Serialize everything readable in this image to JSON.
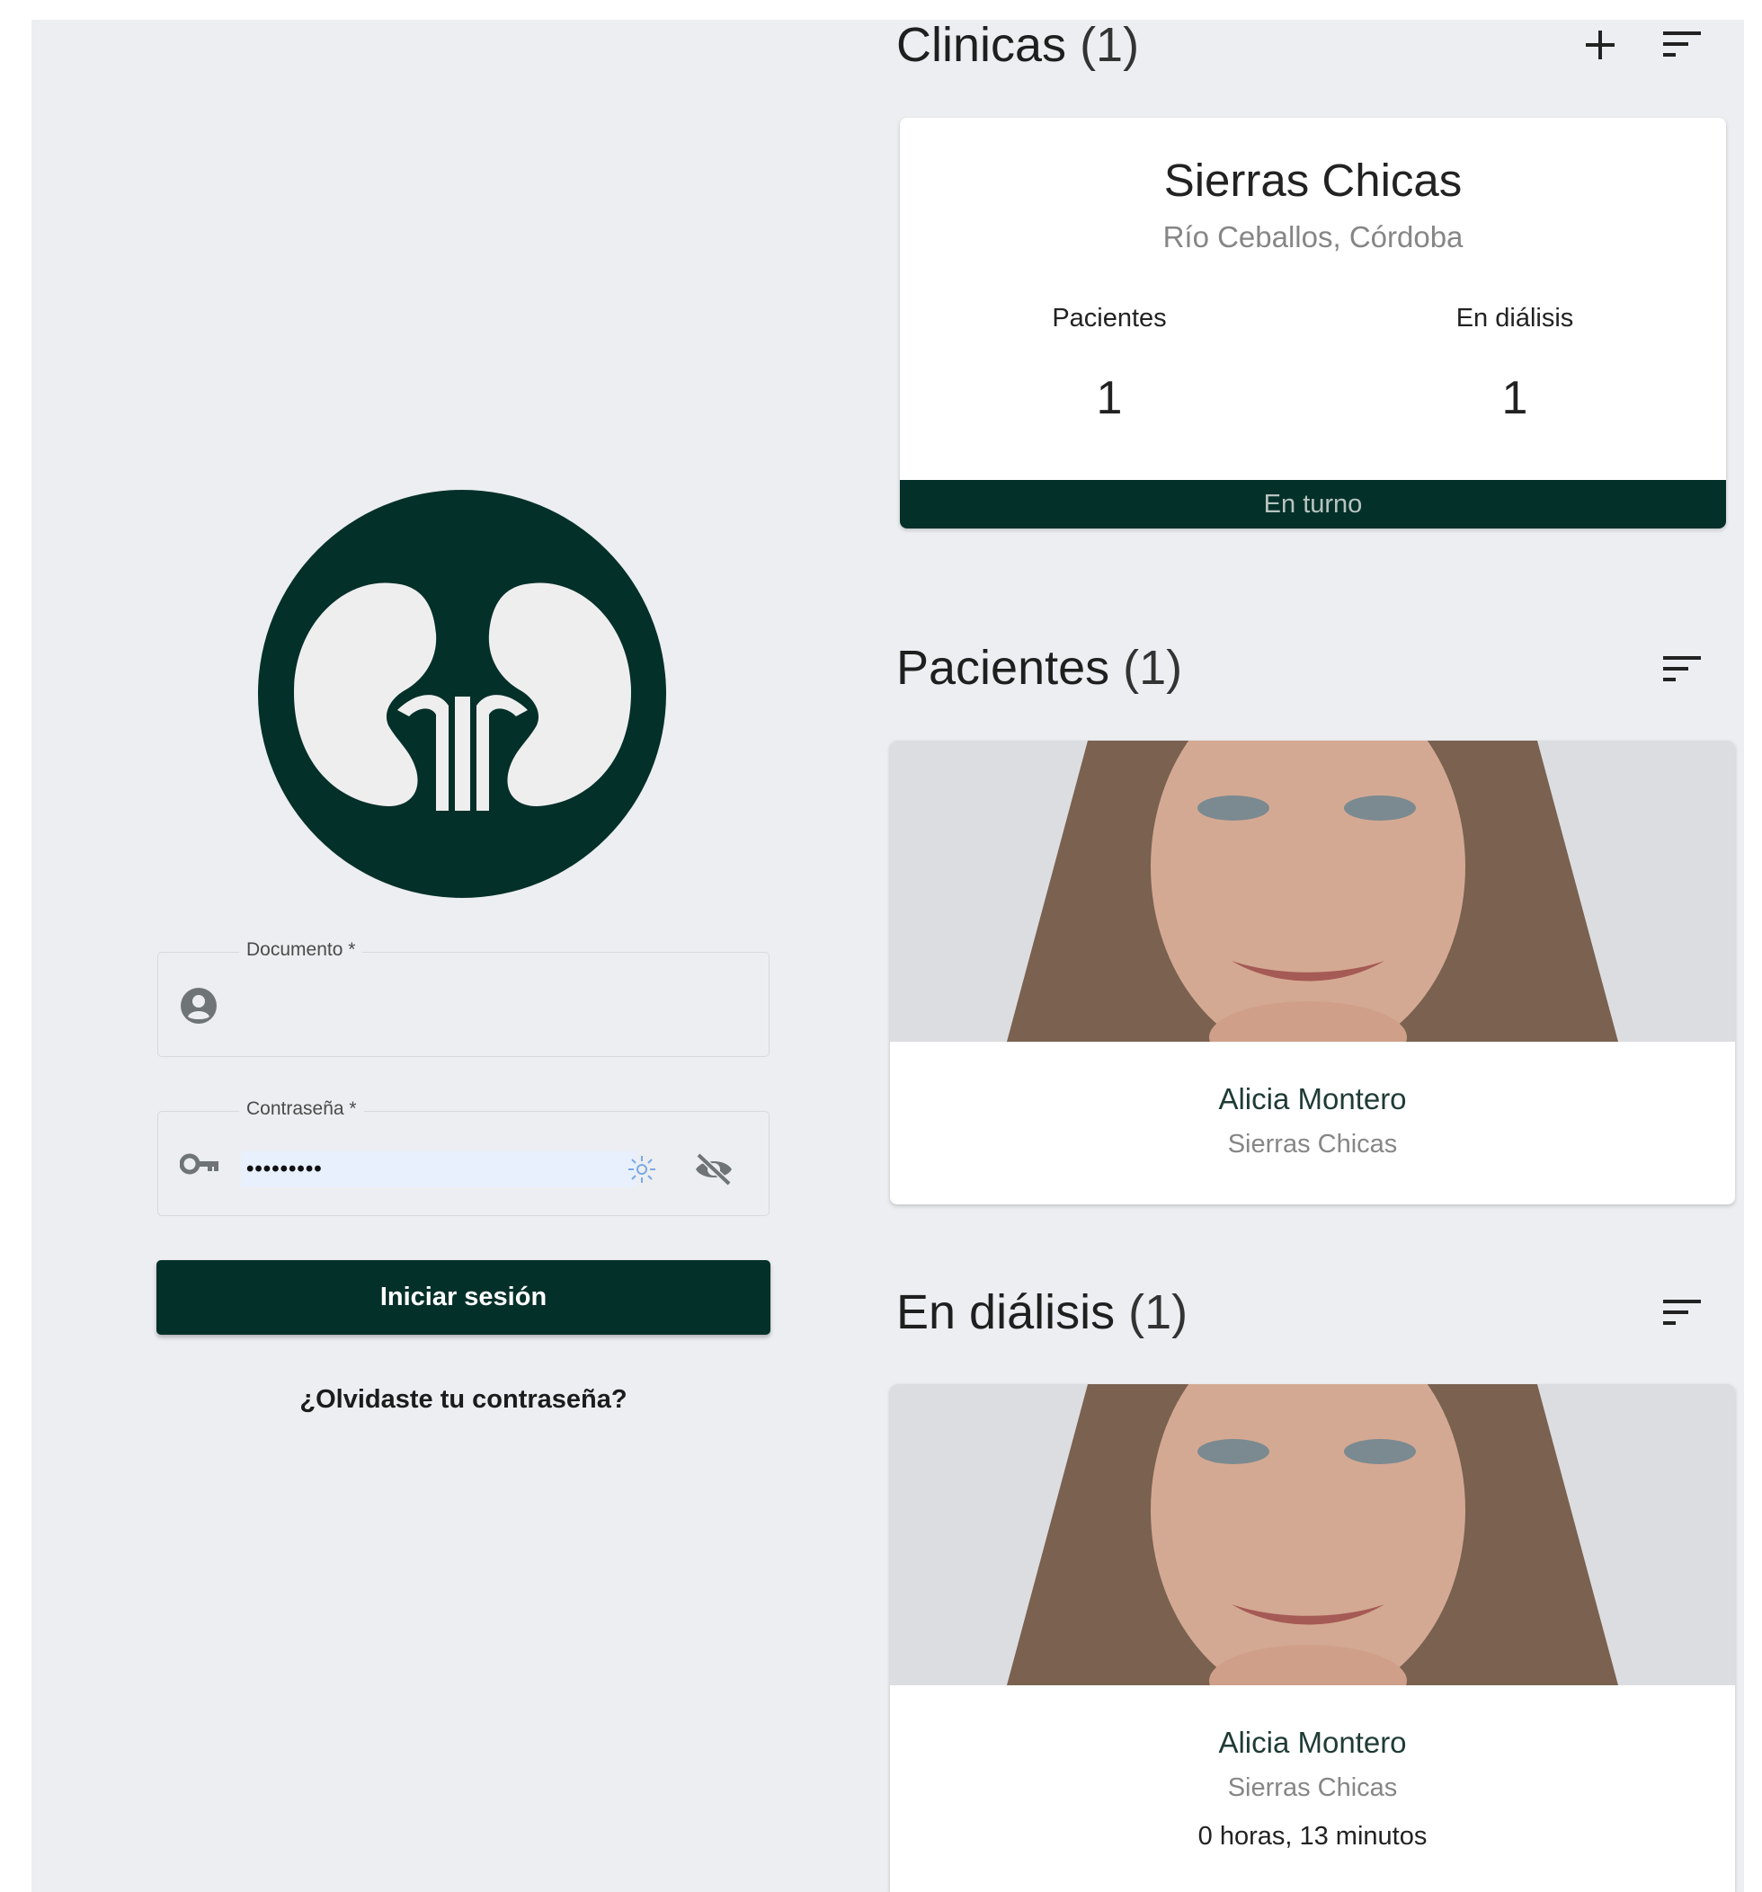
{
  "login": {
    "document_label": "Documento *",
    "document_value": "",
    "password_label": "Contraseña *",
    "password_value": "•••••••••",
    "submit_label": "Iniciar sesión",
    "forgot_label": "¿Olvidaste tu contraseña?"
  },
  "clinics": {
    "title": "Clinicas",
    "count": "(1)",
    "card": {
      "name": "Sierras Chicas",
      "location": "Río Ceballos, Córdoba",
      "patients_label": "Pacientes",
      "patients_value": "1",
      "dialysis_label": "En diálisis",
      "dialysis_value": "1",
      "status": "En turno"
    }
  },
  "patients": {
    "title": "Pacientes",
    "count": "(1)",
    "items": [
      {
        "name": "Alicia Montero",
        "clinic": "Sierras Chicas"
      }
    ]
  },
  "dialysis": {
    "title": "En diálisis",
    "count": "(1)",
    "items": [
      {
        "name": "Alicia Montero",
        "clinic": "Sierras Chicas",
        "duration": "0 horas, 13 minutos"
      }
    ]
  },
  "colors": {
    "brand_dark_green": "#04302a",
    "background": "#eceef1",
    "card": "#ffffff",
    "muted_text": "#868686"
  },
  "icons": [
    "kidney-logo-icon",
    "account-circle-icon",
    "key-icon",
    "password-manager-icon",
    "eye-off-icon",
    "plus-icon",
    "sort-icon"
  ]
}
